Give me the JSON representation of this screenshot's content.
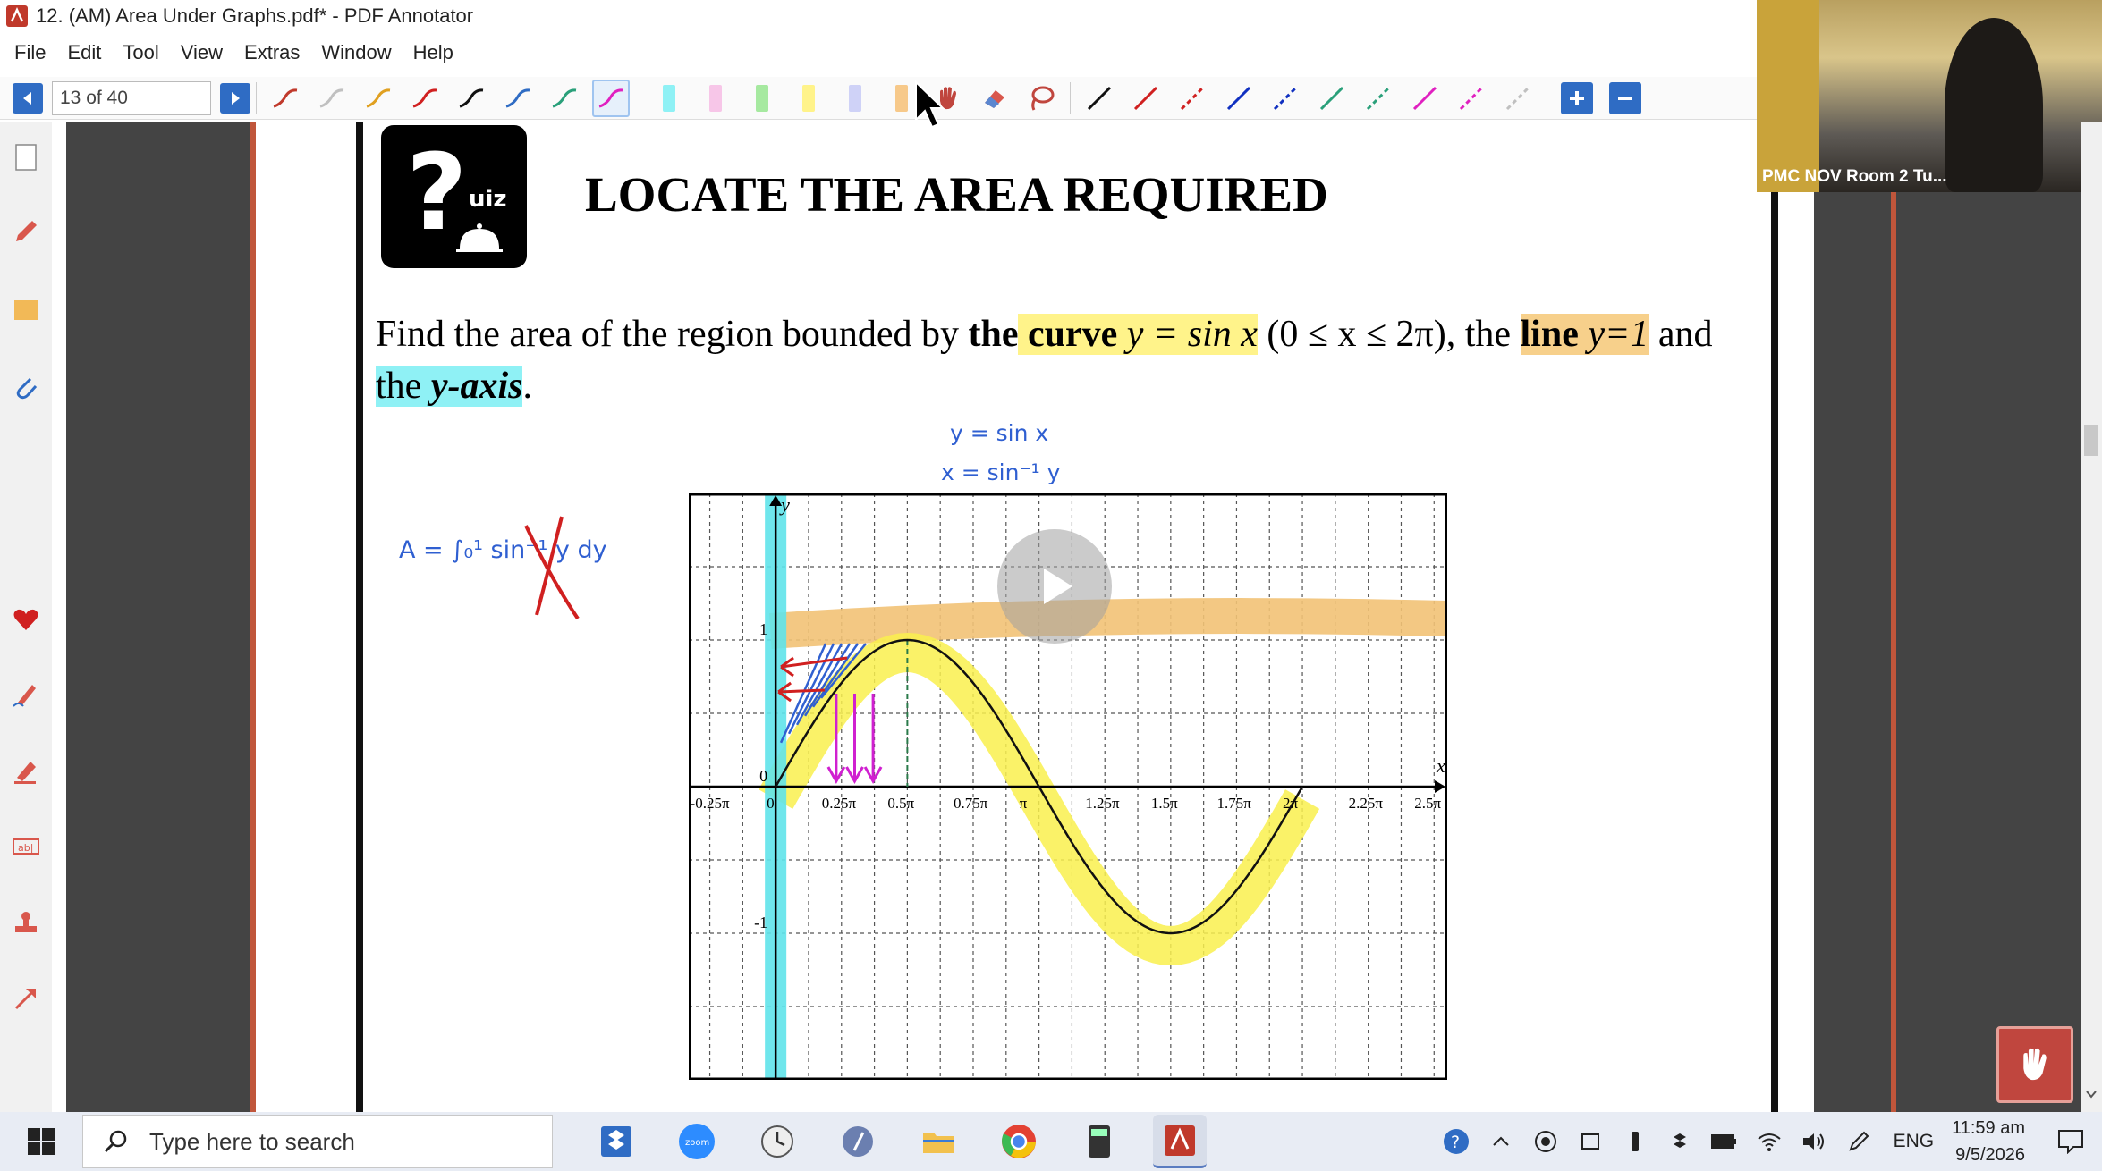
{
  "window": {
    "title": "12. (AM) Area Under Graphs.pdf* - PDF Annotator"
  },
  "menu": [
    "File",
    "Edit",
    "Tool",
    "View",
    "Extras",
    "Window",
    "Help"
  ],
  "toolbar": {
    "page_indicator": "13 of 40",
    "pen_colors": [
      "#c0392b",
      "#c0c0c0",
      "#e0a020",
      "#d02020",
      "#111111",
      "#2f6cc4",
      "#2aa07a",
      "#e020c0"
    ],
    "highlighter_colors": [
      "#8ff1f5",
      "#f7c6e8",
      "#a6e9a0",
      "#fff38a",
      "#cfd2f7",
      "#f7c98a"
    ],
    "line_colors": [
      "#111111",
      "#d02020",
      "#d02020",
      "#1030c0",
      "#1030c0",
      "#2aa07a",
      "#2aa07a",
      "#e020c0",
      "#e020c0",
      "#c0c0c0"
    ]
  },
  "webcam": {
    "label": "PMC NOV Room 2 Tu..."
  },
  "document": {
    "heading": "LOCATE THE AREA REQUIRED",
    "quiz_logo_q": "?",
    "quiz_logo_text": "uiz",
    "question": {
      "part1": "Find the area of the region bounded by",
      "the1": "the",
      "curve": "curve",
      "curve_eq": "y = sin x",
      "domain": "(0 ≤ x ≤ 2π)",
      "comma_the": ", the",
      "line": "line",
      "line_eq": "y=1",
      "and": "and",
      "line2_the": "the",
      "y_axis": "y-axis",
      "period": "."
    }
  },
  "notes": {
    "eq1": "y = sin x",
    "eq2": "x = sin⁻¹ y",
    "integral": "A = ∫₀¹ sin⁻¹ y  dy"
  },
  "chart_data": {
    "type": "line",
    "x_tick_labels": [
      "-0.25π",
      "0",
      "0.25π",
      "0.5π",
      "0.75π",
      "π",
      "1.25π",
      "1.5π",
      "1.75π",
      "2π",
      "2.25π",
      "2.5π"
    ],
    "y_tick_labels": [
      "1",
      "0",
      "-1"
    ],
    "xlabel": "x",
    "ylabel": "y",
    "xlim_pi": [
      -0.33,
      2.55
    ],
    "ylim": [
      -2.0,
      2.0
    ],
    "grid": true,
    "series": [
      {
        "values_desc": "y = sin x on [0, 2π]",
        "color": "#111111"
      }
    ]
  },
  "taskbar": {
    "search_placeholder": "Type here to search",
    "language": "ENG",
    "time": "11:59 am",
    "date": "9/5/2026"
  }
}
